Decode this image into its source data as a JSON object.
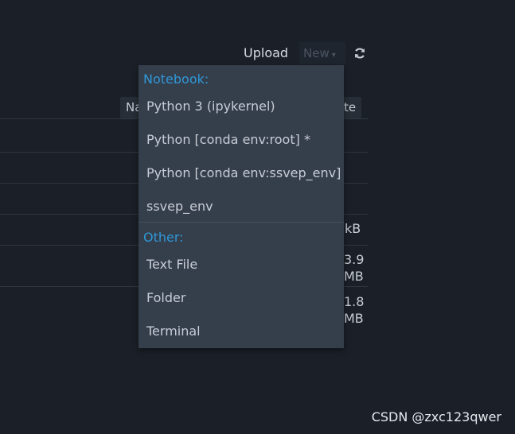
{
  "toolbar": {
    "upload_label": "Upload",
    "new_label": "New",
    "refresh_icon": "refresh-icon"
  },
  "table": {
    "name_header": "Na",
    "date_header": "te",
    "sizes": [
      {
        "line1": "kB",
        "line2": ""
      },
      {
        "line1": "3.9",
        "line2": "MB"
      },
      {
        "line1": "1.8",
        "line2": "MB"
      }
    ]
  },
  "new_menu": {
    "notebook_header": "Notebook:",
    "notebook_items": [
      "Python 3 (ipykernel)",
      "Python [conda env:root] *",
      "Python [conda env:ssvep_env]",
      "ssvep_env"
    ],
    "other_header": "Other:",
    "other_items": [
      "Text File",
      "Folder",
      "Terminal"
    ]
  },
  "watermark": "CSDN @zxc123qwer",
  "colors": {
    "background": "#1b2028",
    "menu_bg": "#353e4b",
    "menu_header": "#2f98d8"
  }
}
